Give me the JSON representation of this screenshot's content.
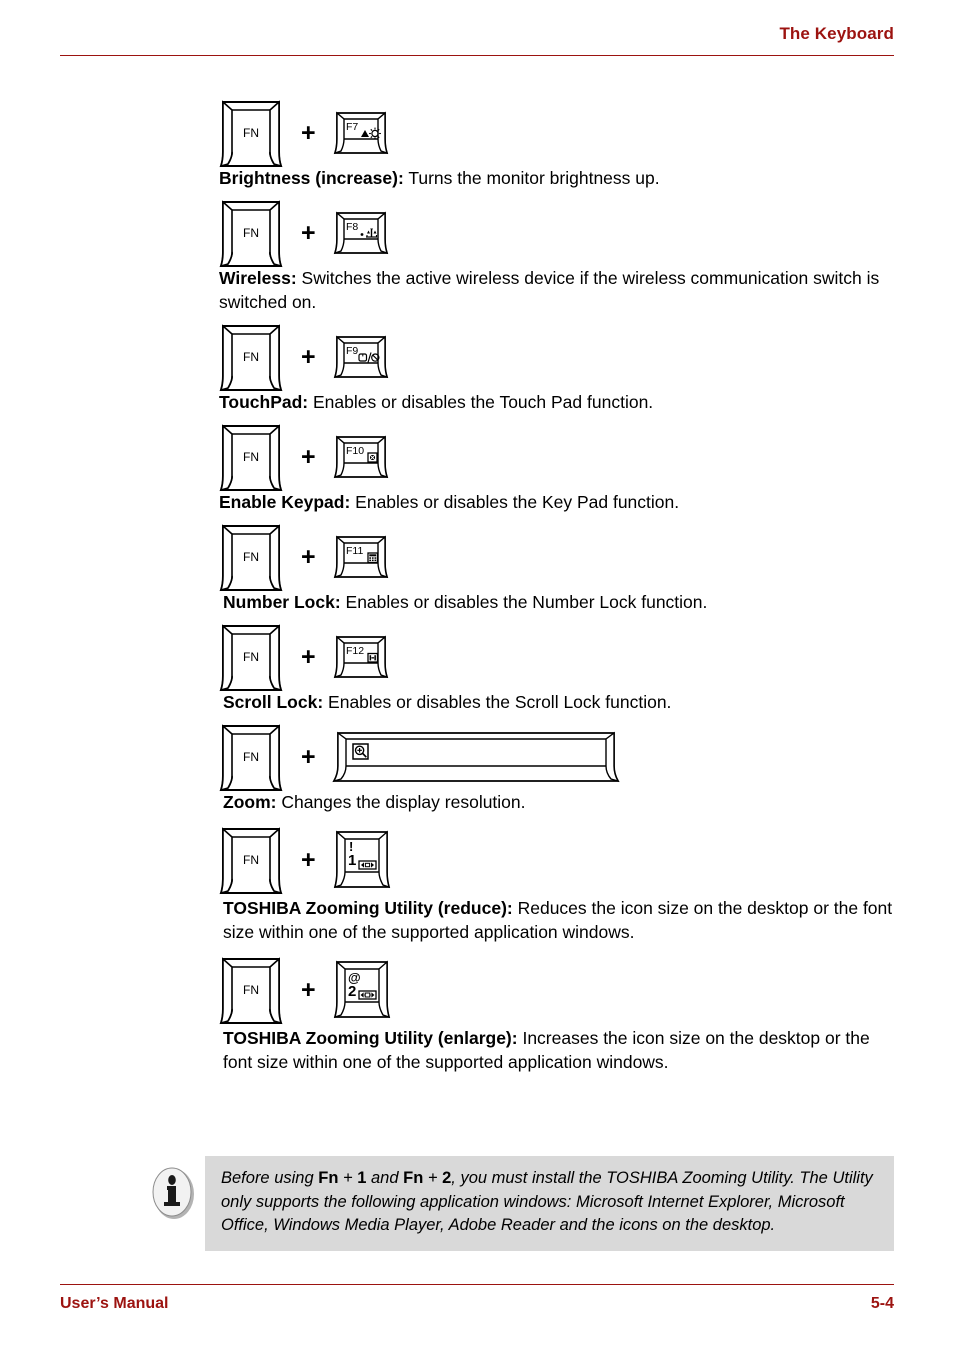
{
  "header": {
    "title": "The Keyboard",
    "rule_color": "#9c1310"
  },
  "footer": {
    "left": "User’s Manual",
    "right": "5-4",
    "rule_color": "#9c1310"
  },
  "keys": {
    "fn_label": "FN",
    "plus": "+"
  },
  "entries": [
    {
      "key_label": "F7",
      "key_icon": "brightness-up-icon",
      "term": "Brightness (increase):",
      "text": " Turns the monitor brightness up."
    },
    {
      "key_label": "F8",
      "key_icon": "wireless-icon",
      "term": "Wireless:",
      "text": " Switches the active wireless device if the wireless communication switch is switched on."
    },
    {
      "key_label": "F9",
      "key_icon": "touchpad-icon",
      "term": "TouchPad:",
      "text": " Enables or disables the Touch Pad function."
    },
    {
      "key_label": "F10",
      "key_icon": "keypad-icon",
      "term": "Enable Keypad:",
      "text": " Enables or disables the Key Pad function."
    },
    {
      "key_label": "F11",
      "key_icon": "number-lock-icon",
      "term": "Number Lock:",
      "text": " Enables or disables the Number Lock function."
    },
    {
      "key_label": "F12",
      "key_icon": "scroll-lock-icon",
      "term": "Scroll Lock:",
      "text": " Enables or disables the Scroll Lock function."
    },
    {
      "key_label": "",
      "key_icon": "zoom-magnifier-icon",
      "term": "Zoom:",
      "text": " Changes the display resolution."
    },
    {
      "key_label": "1",
      "key_shift_label": "!",
      "key_icon": "zoom-reduce-icon",
      "term": "TOSHIBA Zooming Utility (reduce):",
      "text": " Reduces the icon size on the desktop or the font size within one of the supported application windows."
    },
    {
      "key_label": "2",
      "key_shift_label": "@",
      "key_icon": "zoom-enlarge-icon",
      "term": "TOSHIBA Zooming Utility (enlarge):",
      "text": " Increases the icon size on the desktop or the font size within one of the supported application windows."
    }
  ],
  "note": {
    "icon": "info-icon",
    "background": "#d9d9d9",
    "part1": "Before using ",
    "bold1": "Fn",
    "plus1": " + ",
    "bold2": "1",
    "mid": " and ",
    "bold3": "Fn",
    "plus2": " + ",
    "bold4": "2",
    "part2": ", you must install the TOSHIBA Zooming Utility. The Utility only supports the following application windows: Microsoft Internet Explorer, Microsoft Office, Windows Media Player, Adobe Reader and the icons on the desktop."
  }
}
